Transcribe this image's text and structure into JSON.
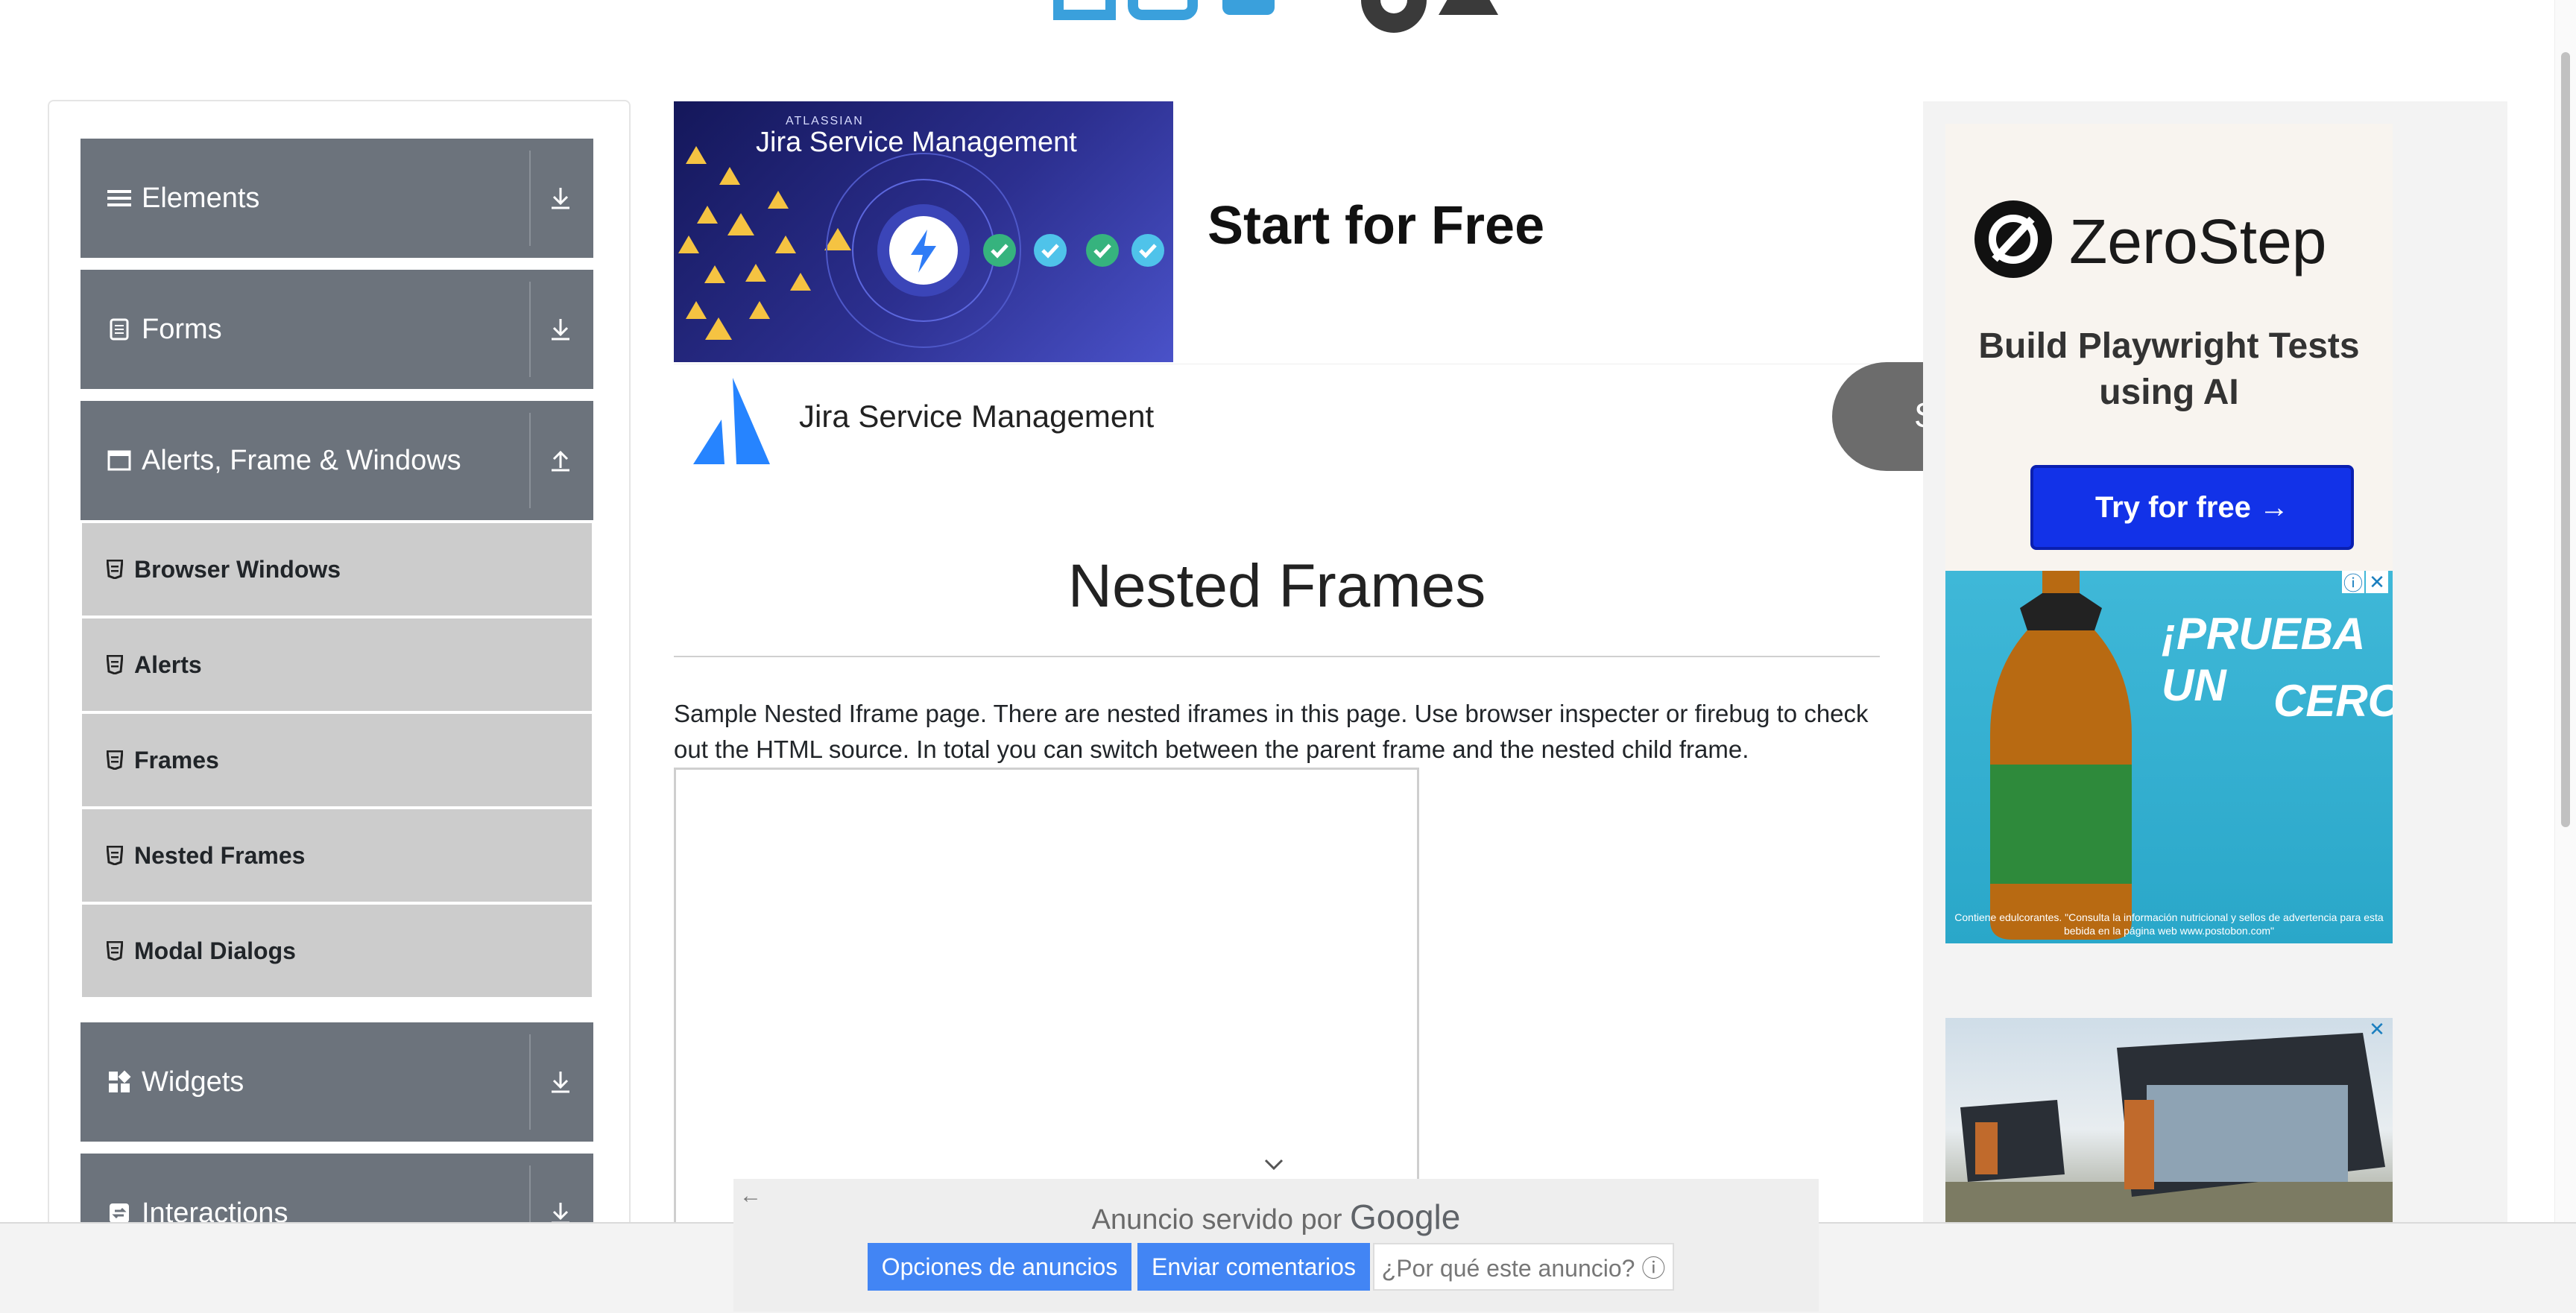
{
  "sidebar": {
    "groups": [
      {
        "label": "Elements",
        "icon": "hamburger-icon",
        "arrow": "download-arrow-icon"
      },
      {
        "label": "Forms",
        "icon": "document-icon",
        "arrow": "download-arrow-icon"
      },
      {
        "label": "Alerts, Frame & Windows",
        "icon": "window-icon",
        "arrow": "upload-arrow-icon"
      },
      {
        "label": "Widgets",
        "icon": "widgets-icon",
        "arrow": "download-arrow-icon"
      },
      {
        "label": "Interactions",
        "icon": "interactions-icon",
        "arrow": "download-arrow-icon"
      }
    ],
    "sub_items": [
      {
        "label": "Browser Windows"
      },
      {
        "label": "Alerts"
      },
      {
        "label": "Frames"
      },
      {
        "label": "Nested Frames"
      },
      {
        "label": "Modal Dialogs"
      }
    ]
  },
  "top_ad": {
    "brand_small": "ATLASSIAN",
    "brand": "Jira Service Management",
    "headline": "Start for Free",
    "label": "Jira Service Management",
    "cta_partial": "S"
  },
  "main": {
    "title": "Nested Frames",
    "description": "Sample Nested Iframe page. There are nested iframes in this page. Use browser inspecter or firebug to check out the HTML source. In total you can switch between the parent frame and the nested child frame."
  },
  "right_ads": {
    "zerostep_name": "ZeroStep",
    "zerostep_tag": "Build Playwright Tests using AI",
    "zerostep_btn": "Try for free →",
    "tea_line1": "¡PRUEBA UN",
    "tea_line2": "CERO",
    "tea_fine": "Contiene edulcorantes. \"Consulta la información nutricional y sellos de advertencia para esta bebida en la página web www.postobon.com\""
  },
  "google_bar": {
    "served_prefix": "Anuncio servido por",
    "served_brand": "Google",
    "btn_options": "Opciones de anuncios",
    "btn_feedback": "Enviar comentarios",
    "btn_why": "¿Por qué este anuncio? ⓘ"
  },
  "colors": {
    "sidebar_header": "#6c737c",
    "sidebar_sub": "#cccccc",
    "google_blue": "#4285f4",
    "zerostep_button": "#1232e8"
  }
}
